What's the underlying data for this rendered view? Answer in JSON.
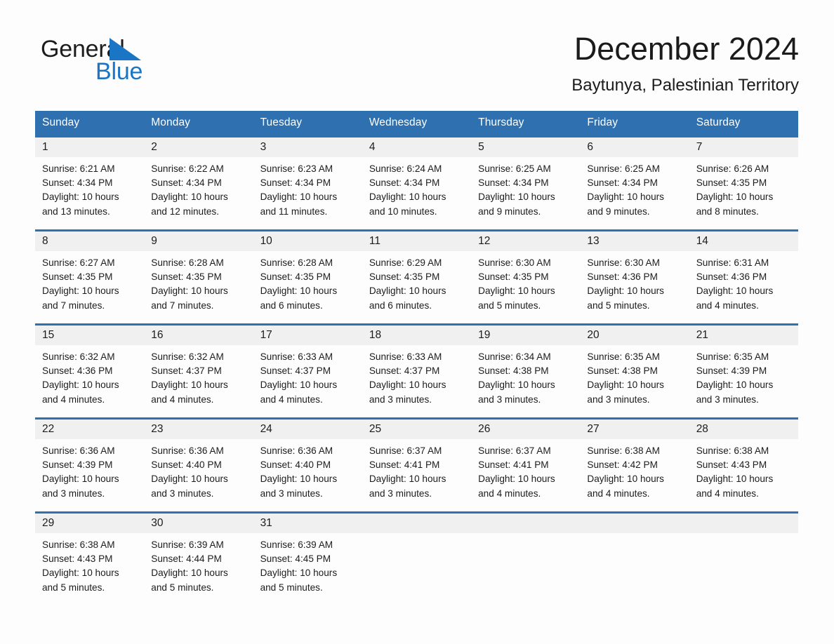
{
  "brand": {
    "name_part1": "General",
    "name_part2": "Blue",
    "triangle_color": "#1a76c4",
    "text_color": "#1c1c1c"
  },
  "header": {
    "title": "December 2024",
    "subtitle": "Baytunya, Palestinian Territory"
  },
  "theme": {
    "header_blue": "#2e70b0",
    "row_rule_blue": "#2e70b0",
    "day_band_gray": "#f0f0f0",
    "page_background": "#fdfdfd",
    "text": "#1c1c1c"
  },
  "weekday_headers": [
    "Sunday",
    "Monday",
    "Tuesday",
    "Wednesday",
    "Thursday",
    "Friday",
    "Saturday"
  ],
  "labels": {
    "sunrise_prefix": "Sunrise:",
    "sunset_prefix": "Sunset:",
    "daylight_prefix": "Daylight:"
  },
  "weeks": [
    [
      {
        "day": "1",
        "sunrise": "Sunrise: 6:21 AM",
        "sunset": "Sunset: 4:34 PM",
        "daylight_line1": "Daylight: 10 hours",
        "daylight_line2": "and 13 minutes."
      },
      {
        "day": "2",
        "sunrise": "Sunrise: 6:22 AM",
        "sunset": "Sunset: 4:34 PM",
        "daylight_line1": "Daylight: 10 hours",
        "daylight_line2": "and 12 minutes."
      },
      {
        "day": "3",
        "sunrise": "Sunrise: 6:23 AM",
        "sunset": "Sunset: 4:34 PM",
        "daylight_line1": "Daylight: 10 hours",
        "daylight_line2": "and 11 minutes."
      },
      {
        "day": "4",
        "sunrise": "Sunrise: 6:24 AM",
        "sunset": "Sunset: 4:34 PM",
        "daylight_line1": "Daylight: 10 hours",
        "daylight_line2": "and 10 minutes."
      },
      {
        "day": "5",
        "sunrise": "Sunrise: 6:25 AM",
        "sunset": "Sunset: 4:34 PM",
        "daylight_line1": "Daylight: 10 hours",
        "daylight_line2": "and 9 minutes."
      },
      {
        "day": "6",
        "sunrise": "Sunrise: 6:25 AM",
        "sunset": "Sunset: 4:34 PM",
        "daylight_line1": "Daylight: 10 hours",
        "daylight_line2": "and 9 minutes."
      },
      {
        "day": "7",
        "sunrise": "Sunrise: 6:26 AM",
        "sunset": "Sunset: 4:35 PM",
        "daylight_line1": "Daylight: 10 hours",
        "daylight_line2": "and 8 minutes."
      }
    ],
    [
      {
        "day": "8",
        "sunrise": "Sunrise: 6:27 AM",
        "sunset": "Sunset: 4:35 PM",
        "daylight_line1": "Daylight: 10 hours",
        "daylight_line2": "and 7 minutes."
      },
      {
        "day": "9",
        "sunrise": "Sunrise: 6:28 AM",
        "sunset": "Sunset: 4:35 PM",
        "daylight_line1": "Daylight: 10 hours",
        "daylight_line2": "and 7 minutes."
      },
      {
        "day": "10",
        "sunrise": "Sunrise: 6:28 AM",
        "sunset": "Sunset: 4:35 PM",
        "daylight_line1": "Daylight: 10 hours",
        "daylight_line2": "and 6 minutes."
      },
      {
        "day": "11",
        "sunrise": "Sunrise: 6:29 AM",
        "sunset": "Sunset: 4:35 PM",
        "daylight_line1": "Daylight: 10 hours",
        "daylight_line2": "and 6 minutes."
      },
      {
        "day": "12",
        "sunrise": "Sunrise: 6:30 AM",
        "sunset": "Sunset: 4:35 PM",
        "daylight_line1": "Daylight: 10 hours",
        "daylight_line2": "and 5 minutes."
      },
      {
        "day": "13",
        "sunrise": "Sunrise: 6:30 AM",
        "sunset": "Sunset: 4:36 PM",
        "daylight_line1": "Daylight: 10 hours",
        "daylight_line2": "and 5 minutes."
      },
      {
        "day": "14",
        "sunrise": "Sunrise: 6:31 AM",
        "sunset": "Sunset: 4:36 PM",
        "daylight_line1": "Daylight: 10 hours",
        "daylight_line2": "and 4 minutes."
      }
    ],
    [
      {
        "day": "15",
        "sunrise": "Sunrise: 6:32 AM",
        "sunset": "Sunset: 4:36 PM",
        "daylight_line1": "Daylight: 10 hours",
        "daylight_line2": "and 4 minutes."
      },
      {
        "day": "16",
        "sunrise": "Sunrise: 6:32 AM",
        "sunset": "Sunset: 4:37 PM",
        "daylight_line1": "Daylight: 10 hours",
        "daylight_line2": "and 4 minutes."
      },
      {
        "day": "17",
        "sunrise": "Sunrise: 6:33 AM",
        "sunset": "Sunset: 4:37 PM",
        "daylight_line1": "Daylight: 10 hours",
        "daylight_line2": "and 4 minutes."
      },
      {
        "day": "18",
        "sunrise": "Sunrise: 6:33 AM",
        "sunset": "Sunset: 4:37 PM",
        "daylight_line1": "Daylight: 10 hours",
        "daylight_line2": "and 3 minutes."
      },
      {
        "day": "19",
        "sunrise": "Sunrise: 6:34 AM",
        "sunset": "Sunset: 4:38 PM",
        "daylight_line1": "Daylight: 10 hours",
        "daylight_line2": "and 3 minutes."
      },
      {
        "day": "20",
        "sunrise": "Sunrise: 6:35 AM",
        "sunset": "Sunset: 4:38 PM",
        "daylight_line1": "Daylight: 10 hours",
        "daylight_line2": "and 3 minutes."
      },
      {
        "day": "21",
        "sunrise": "Sunrise: 6:35 AM",
        "sunset": "Sunset: 4:39 PM",
        "daylight_line1": "Daylight: 10 hours",
        "daylight_line2": "and 3 minutes."
      }
    ],
    [
      {
        "day": "22",
        "sunrise": "Sunrise: 6:36 AM",
        "sunset": "Sunset: 4:39 PM",
        "daylight_line1": "Daylight: 10 hours",
        "daylight_line2": "and 3 minutes."
      },
      {
        "day": "23",
        "sunrise": "Sunrise: 6:36 AM",
        "sunset": "Sunset: 4:40 PM",
        "daylight_line1": "Daylight: 10 hours",
        "daylight_line2": "and 3 minutes."
      },
      {
        "day": "24",
        "sunrise": "Sunrise: 6:36 AM",
        "sunset": "Sunset: 4:40 PM",
        "daylight_line1": "Daylight: 10 hours",
        "daylight_line2": "and 3 minutes."
      },
      {
        "day": "25",
        "sunrise": "Sunrise: 6:37 AM",
        "sunset": "Sunset: 4:41 PM",
        "daylight_line1": "Daylight: 10 hours",
        "daylight_line2": "and 3 minutes."
      },
      {
        "day": "26",
        "sunrise": "Sunrise: 6:37 AM",
        "sunset": "Sunset: 4:41 PM",
        "daylight_line1": "Daylight: 10 hours",
        "daylight_line2": "and 4 minutes."
      },
      {
        "day": "27",
        "sunrise": "Sunrise: 6:38 AM",
        "sunset": "Sunset: 4:42 PM",
        "daylight_line1": "Daylight: 10 hours",
        "daylight_line2": "and 4 minutes."
      },
      {
        "day": "28",
        "sunrise": "Sunrise: 6:38 AM",
        "sunset": "Sunset: 4:43 PM",
        "daylight_line1": "Daylight: 10 hours",
        "daylight_line2": "and 4 minutes."
      }
    ],
    [
      {
        "day": "29",
        "sunrise": "Sunrise: 6:38 AM",
        "sunset": "Sunset: 4:43 PM",
        "daylight_line1": "Daylight: 10 hours",
        "daylight_line2": "and 5 minutes."
      },
      {
        "day": "30",
        "sunrise": "Sunrise: 6:39 AM",
        "sunset": "Sunset: 4:44 PM",
        "daylight_line1": "Daylight: 10 hours",
        "daylight_line2": "and 5 minutes."
      },
      {
        "day": "31",
        "sunrise": "Sunrise: 6:39 AM",
        "sunset": "Sunset: 4:45 PM",
        "daylight_line1": "Daylight: 10 hours",
        "daylight_line2": "and 5 minutes."
      },
      {
        "day": "",
        "sunrise": "",
        "sunset": "",
        "daylight_line1": "",
        "daylight_line2": ""
      },
      {
        "day": "",
        "sunrise": "",
        "sunset": "",
        "daylight_line1": "",
        "daylight_line2": ""
      },
      {
        "day": "",
        "sunrise": "",
        "sunset": "",
        "daylight_line1": "",
        "daylight_line2": ""
      },
      {
        "day": "",
        "sunrise": "",
        "sunset": "",
        "daylight_line1": "",
        "daylight_line2": ""
      }
    ]
  ]
}
